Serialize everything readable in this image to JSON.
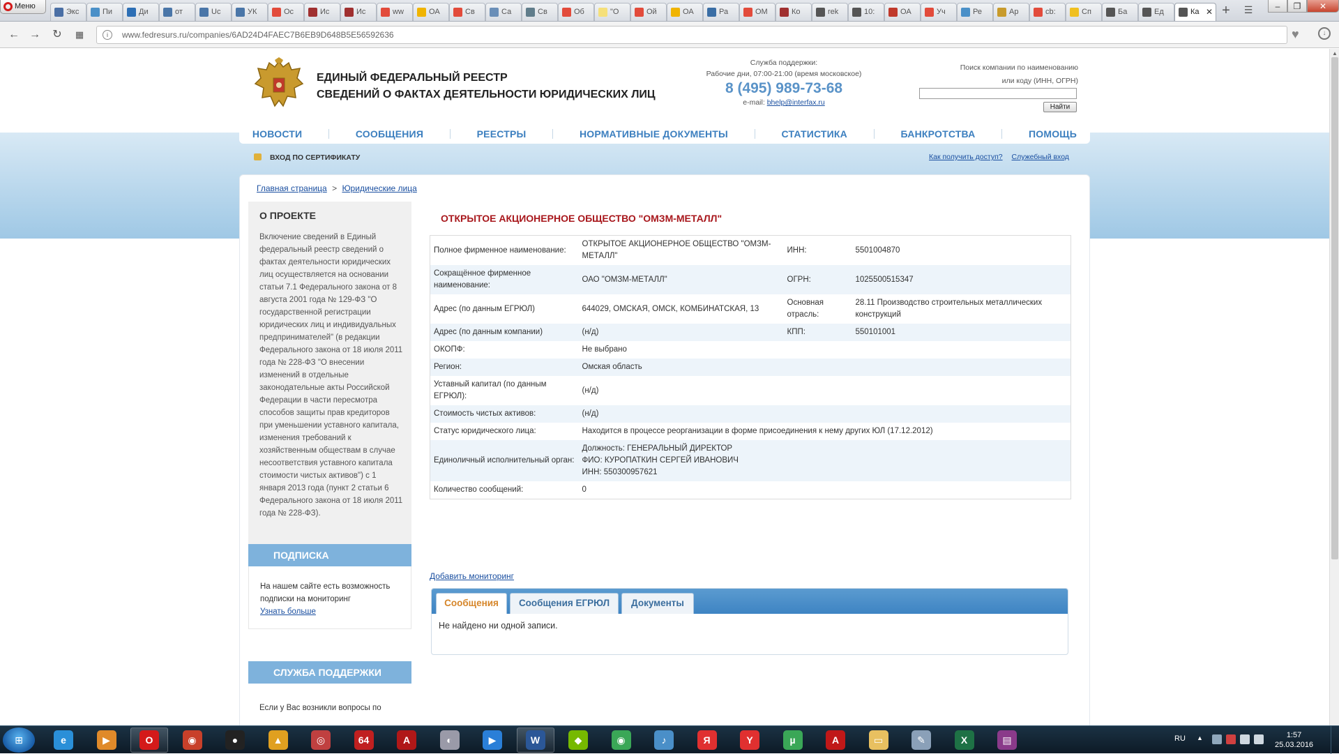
{
  "browser": {
    "menu_label": "Меню",
    "tabs": [
      {
        "label": "Экс",
        "fav": "#4a6fa5"
      },
      {
        "label": "Пи",
        "fav": "#4a90c8"
      },
      {
        "label": "Ди",
        "fav": "#2d6fb5"
      },
      {
        "label": "от",
        "fav": "#4a76a8"
      },
      {
        "label": "Uc",
        "fav": "#4a76a8"
      },
      {
        "label": "УК",
        "fav": "#4a76a8"
      },
      {
        "label": "Ос",
        "fav": "#e24b3b"
      },
      {
        "label": "Ис",
        "fav": "#a03030"
      },
      {
        "label": "Ис",
        "fav": "#a03030"
      },
      {
        "label": "ww",
        "fav": "#e24b3b"
      },
      {
        "label": "ОА",
        "fav": "#f0b400"
      },
      {
        "label": "Св",
        "fav": "#e24b3b"
      },
      {
        "label": "Са",
        "fav": "#6a8fb8"
      },
      {
        "label": "Св",
        "fav": "#607d8b"
      },
      {
        "label": "Об",
        "fav": "#e24b3b"
      },
      {
        "label": "\"О",
        "fav": "#f5e07a"
      },
      {
        "label": "Ой",
        "fav": "#e24b3b"
      },
      {
        "label": "ОА",
        "fav": "#f0b400"
      },
      {
        "label": "Ра",
        "fav": "#3a6ea5"
      },
      {
        "label": "ОМ",
        "fav": "#e24b3b"
      },
      {
        "label": "Ко",
        "fav": "#a03030"
      },
      {
        "label": "rek",
        "fav": "#555"
      },
      {
        "label": "10:",
        "fav": "#555"
      },
      {
        "label": "ОА",
        "fav": "#c0392b"
      },
      {
        "label": "Уч",
        "fav": "#e24b3b"
      },
      {
        "label": "Ре",
        "fav": "#4a90c8"
      },
      {
        "label": "Ар",
        "fav": "#c89b2c"
      },
      {
        "label": "cb:",
        "fav": "#e24b3b"
      },
      {
        "label": "Сп",
        "fav": "#f0c020"
      },
      {
        "label": "Ба",
        "fav": "#555"
      },
      {
        "label": "Ед",
        "fav": "#555"
      },
      {
        "label": "Ка",
        "fav": "#555",
        "active": true
      }
    ],
    "url": "www.fedresurs.ru/companies/6AD24D4FAEC7B6EB9D648B5E56592636"
  },
  "header": {
    "title_line1": "ЕДИНЫЙ ФЕДЕРАЛЬНЫЙ РЕЕСТР",
    "title_line2": "СВЕДЕНИЙ О ФАКТАХ ДЕЯТЕЛЬНОСТИ ЮРИДИЧЕСКИХ ЛИЦ",
    "support_label": "Служба поддержки:",
    "support_hours": "Рабочие дни, 07:00-21:00 (время московское)",
    "support_phone": "8 (495) 989-73-68",
    "support_email_label": "e-mail:",
    "support_email": "bhelp@interfax.ru",
    "search_label_line1": "Поиск компании по наименованию",
    "search_label_line2": "или коду (ИНН, ОГРН)",
    "search_value": "",
    "search_button": "Найти"
  },
  "nav": {
    "items": [
      "НОВОСТИ",
      "СООБЩЕНИЯ",
      "РЕЕСТРЫ",
      "НОРМАТИВНЫЕ ДОКУМЕНТЫ",
      "СТАТИСТИКА",
      "БАНКРОТСТВА",
      "ПОМОЩЬ"
    ],
    "cert_login": "ВХОД ПО СЕРТИФИКАТУ",
    "access_link": "Как получить доступ?",
    "service_link": "Служебный вход"
  },
  "breadcrumb": {
    "home": "Главная страница",
    "sep": ">",
    "current": "Юридические лица"
  },
  "sidebar": {
    "about_title": "О ПРОЕКТЕ",
    "about_text": "Включение сведений в Единый федеральный реестр сведений о фактах деятельности юридических лиц осуществляется на основании статьи 7.1 Федерального закона от 8 августа 2001 года № 129-ФЗ \"О государственной регистрации юридических лиц и индивидуальных предпринимателей\" (в редакции Федерального закона от 18 июля 2011 года № 228-ФЗ \"О внесении изменений в отдельные законодательные акты Российской Федерации в части пересмотра способов защиты прав кредиторов при уменьшении уставного капитала, изменения требований к хозяйственным обществам в случае несоответствия уставного капитала стоимости чистых активов\") с 1 января 2013 года (пункт 2 статьи 6 Федерального закона от 18 июля 2011 года № 228-ФЗ).",
    "subscription_title": "ПОДПИСКА",
    "subscription_text": "На нашем сайте есть возможность подписки на мониторинг",
    "subscription_more": "Узнать больше",
    "support_title": "СЛУЖБА ПОДДЕРЖКИ",
    "support_text": "Если у Вас возникли вопросы по"
  },
  "company": {
    "title": "ОТКРЫТОЕ АКЦИОНЕРНОЕ ОБЩЕСТВО \"ОМЗМ-МЕТАЛЛ\"",
    "rows": [
      {
        "l1": "Полное фирменное наименование:",
        "v1": "ОТКРЫТОЕ АКЦИОНЕРНОЕ ОБЩЕСТВО \"ОМЗМ-МЕТАЛЛ\"",
        "l2": "ИНН:",
        "v2": "5501004870"
      },
      {
        "l1": "Сокращённое фирменное наименование:",
        "v1": "ОАО \"ОМЗМ-МЕТАЛЛ\"",
        "l2": "ОГРН:",
        "v2": "1025500515347"
      },
      {
        "l1": "Адрес (по данным ЕГРЮЛ)",
        "v1": "644029, ОМСКАЯ, ОМСК, КОМБИНАТСКАЯ, 13",
        "l2": "Основная отрасль:",
        "v2": "28.11 Производство строительных металлических конструкций"
      },
      {
        "l1": "Адрес (по данным компании)",
        "v1": "(н/д)",
        "l2": "КПП:",
        "v2": "550101001"
      },
      {
        "l1": "ОКОПФ:",
        "v1": "Не выбрано",
        "l2": "",
        "v2": ""
      },
      {
        "l1": "Регион:",
        "v1": "Омская область",
        "l2": "",
        "v2": ""
      },
      {
        "l1": "Уставный капитал (по данным ЕГРЮЛ):",
        "v1": "(н/д)",
        "l2": "",
        "v2": ""
      },
      {
        "l1": "Стоимость чистых активов:",
        "v1": "(н/д)",
        "l2": "",
        "v2": ""
      },
      {
        "l1": "Статус юридического лица:",
        "v1": "Находится в процессе реорганизации в форме присоединения к нему других ЮЛ (17.12.2012)",
        "l2": "",
        "v2": "",
        "wide": true
      },
      {
        "l1": "Единоличный исполнительный орган:",
        "v1_lines": [
          "Должность: ГЕНЕРАЛЬНЫЙ ДИРЕКТОР",
          "ФИО: КУРОПАТКИН СЕРГЕЙ ИВАНОВИЧ",
          "ИНН: 550300957621"
        ],
        "wide": true
      },
      {
        "l1": "Количество сообщений:",
        "v1": "0",
        "l2": "",
        "v2": ""
      }
    ],
    "monitoring_link": "Добавить мониторинг",
    "tabs": [
      "Сообщения",
      "Сообщения ЕГРЮЛ",
      "Документы"
    ],
    "empty_text": "Не найдено ни одной записи."
  },
  "taskbar": {
    "apps": [
      {
        "name": "ie",
        "label": "e",
        "color": "#2a8fd8"
      },
      {
        "name": "media-player",
        "label": "▶",
        "color": "#e08a2a"
      },
      {
        "name": "opera",
        "label": "O",
        "color": "#d41a1a",
        "open": true
      },
      {
        "name": "app-eye",
        "label": "◉",
        "color": "#c8402a"
      },
      {
        "name": "app-panda",
        "label": "●",
        "color": "#222"
      },
      {
        "name": "app-triangle",
        "label": "▲",
        "color": "#e0a020"
      },
      {
        "name": "app-globe",
        "label": "◎",
        "color": "#c04040"
      },
      {
        "name": "app-64",
        "label": "64",
        "color": "#c02020"
      },
      {
        "name": "app-120x",
        "label": "A",
        "color": "#b01818"
      },
      {
        "name": "app-disc",
        "label": "◐",
        "color": "#9a9aa8"
      },
      {
        "name": "app-play",
        "label": "▶",
        "color": "#2a7fd8"
      },
      {
        "name": "word",
        "label": "W",
        "color": "#2b5797",
        "open": true
      },
      {
        "name": "nvidia",
        "label": "◆",
        "color": "#76b900"
      },
      {
        "name": "chrome",
        "label": "◉",
        "color": "#3aa757"
      },
      {
        "name": "speaker",
        "label": "♪",
        "color": "#4a8fc8"
      },
      {
        "name": "yandex",
        "label": "Я",
        "color": "#e03030"
      },
      {
        "name": "yandex-browser",
        "label": "Y",
        "color": "#e03030"
      },
      {
        "name": "utorrent",
        "label": "µ",
        "color": "#3aa757"
      },
      {
        "name": "acrobat",
        "label": "A",
        "color": "#c01818"
      },
      {
        "name": "explorer",
        "label": "▭",
        "color": "#e8c060"
      },
      {
        "name": "app-tools",
        "label": "✎",
        "color": "#8aa0b8"
      },
      {
        "name": "excel",
        "label": "X",
        "color": "#1e7145"
      },
      {
        "name": "winrar",
        "label": "▤",
        "color": "#8a3a8a"
      }
    ],
    "lang": "RU",
    "time": "1:57",
    "date": "25.03.2016"
  }
}
